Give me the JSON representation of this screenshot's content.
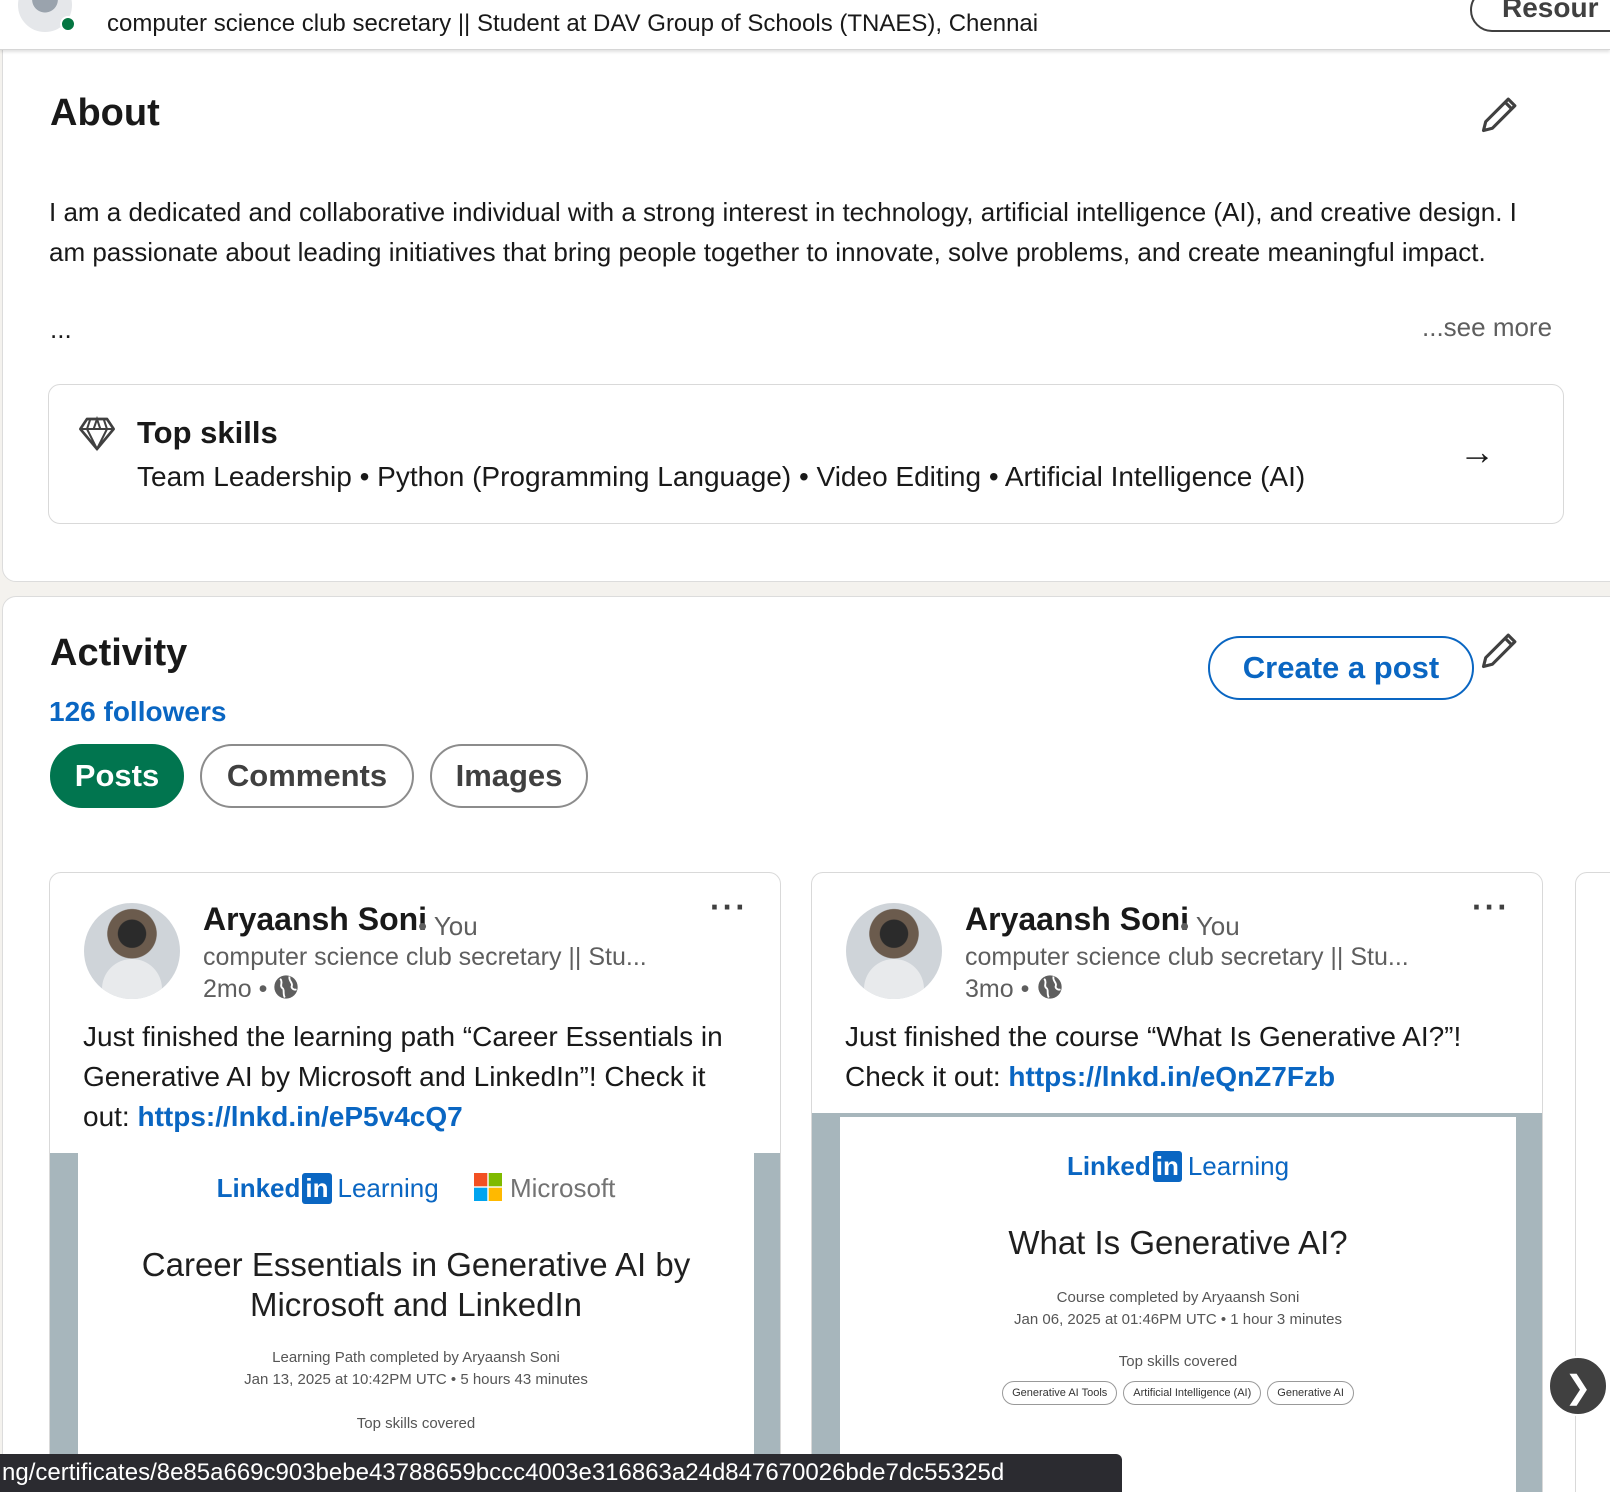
{
  "header": {
    "headline": "computer science club secretary || Student at DAV Group of Schools (TNAES), Chennai",
    "resources_label": "Resour"
  },
  "about": {
    "title": "About",
    "text": "I am a dedicated and collaborative individual with a strong interest in technology, artificial intelligence (AI), and creative design. I am passionate about leading initiatives that bring people together to innovate, solve problems, and create meaningful impact.",
    "ellipsis": "...",
    "see_more": "...see more",
    "top_skills": {
      "title": "Top skills",
      "list": "Team Leadership • Python (Programming Language) • Video Editing • Artificial Intelligence (AI)"
    }
  },
  "activity": {
    "title": "Activity",
    "followers": "126 followers",
    "create_post_label": "Create a post",
    "tabs": [
      {
        "label": "Posts",
        "active": true
      },
      {
        "label": "Comments",
        "active": false
      },
      {
        "label": "Images",
        "active": false
      }
    ],
    "posts": [
      {
        "author": "Aryaansh Soni",
        "you": "• You",
        "headline": "computer science club secretary || Stu...",
        "time": "2mo •",
        "more": "···",
        "text": "Just finished the learning path “Career Essentials in Generative AI by Microsoft and LinkedIn”! Check it out: ",
        "link": "https://lnkd.in/eP5v4cQ7",
        "certificate": {
          "brand_li": "Linked",
          "brand_in": "in",
          "brand_learning": "Learning",
          "partner": "Microsoft",
          "title": "Career Essentials in Generative AI by Microsoft and LinkedIn",
          "completed_by": "Learning Path completed by Aryaansh Soni",
          "date": "Jan 13, 2025 at 10:42PM UTC • 5 hours 43 minutes",
          "skills_heading": "Top skills covered"
        }
      },
      {
        "author": "Aryaansh Soni",
        "you": "• You",
        "headline": "computer science club secretary || Stu...",
        "time": "3mo •",
        "more": "···",
        "text": "Just finished the course “What Is Generative AI?”! Check it out: ",
        "link": "https://lnkd.in/eQnZ7Fzb",
        "certificate": {
          "brand_li": "Linked",
          "brand_in": "in",
          "brand_learning": "Learning",
          "title": "What Is Generative AI?",
          "completed_by": "Course completed by Aryaansh Soni",
          "date": "Jan 06, 2025 at 01:46PM UTC • 1 hour 3 minutes",
          "skills_heading": "Top skills covered",
          "skills": [
            "Generative AI Tools",
            "Artificial Intelligence (AI)",
            "Generative AI"
          ]
        }
      }
    ],
    "carousel_next": "❯"
  },
  "status_bar": {
    "url": "ng/certificates/8e85a669c903bebe43788659bccc4003e316863a24d847670026bde7dc55325d"
  },
  "colors": {
    "accent_blue": "#0a66c2",
    "active_tab_green": "#01754f",
    "online_green": "#057642"
  },
  "icons": [
    "pencil-icon",
    "diamond-icon",
    "arrow-right-icon",
    "globe-icon",
    "more-icon",
    "microsoft-logo",
    "chevron-right-icon"
  ]
}
